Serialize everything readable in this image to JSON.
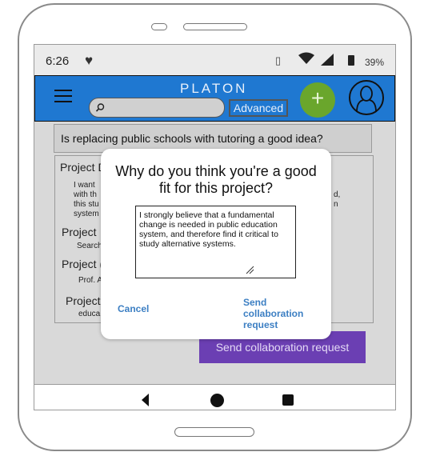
{
  "status_bar": {
    "time": "6:26",
    "battery": "39%"
  },
  "header": {
    "logo": "PLATON",
    "search_placeholder": "",
    "advanced_label": "Advanced",
    "add_label": "+"
  },
  "content": {
    "question": "Is replacing public schools with tutoring a good idea?",
    "sections": [
      {
        "heading": "Project D",
        "lines": [
          "I want",
          "with th",
          "this stu",
          "system"
        ]
      },
      {
        "heading": "Project",
        "lines": [
          "Search"
        ]
      },
      {
        "heading": "Project (",
        "lines": [
          "Prof. A"
        ]
      },
      {
        "heading": "Project",
        "lines": [
          "educa"
        ]
      }
    ],
    "right_fragments": [
      "d,",
      "n"
    ],
    "send_button": "Send collaboration request"
  },
  "modal": {
    "title": "Why do you think you're a good fit for this project?",
    "answer": "I strongly believe that a fundamental change is needed in public education system, and therefore find it critical to study alternative systems.",
    "cancel": "Cancel",
    "send": "Send collaboration request"
  },
  "colors": {
    "header": "#1f78d1",
    "add_button": "#6aa62c",
    "send_button": "#6b3fb3",
    "link": "#3c7fc3"
  }
}
